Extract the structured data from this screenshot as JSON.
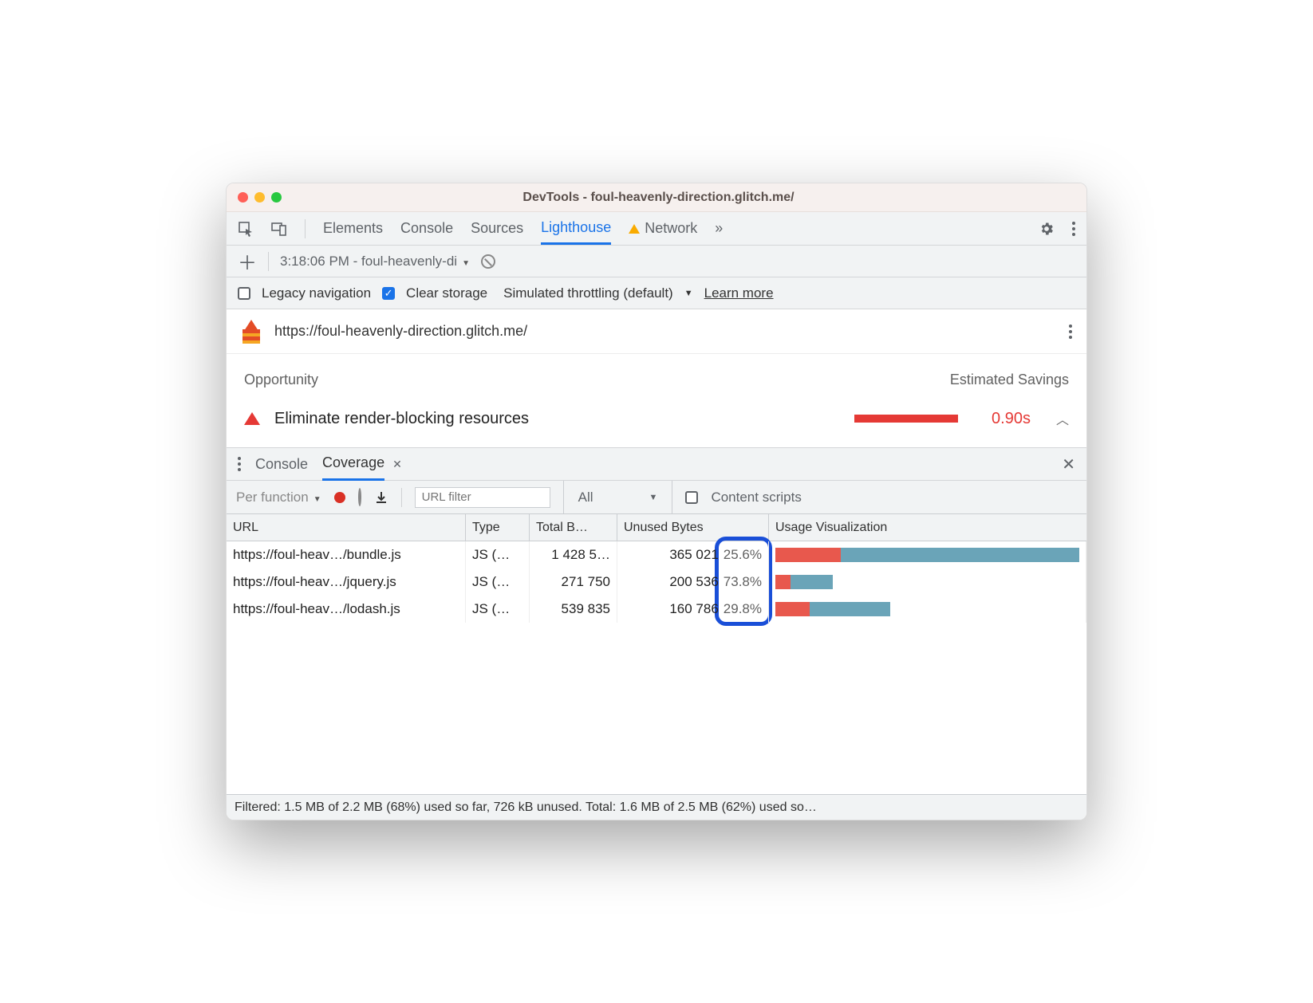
{
  "titlebar": {
    "title": "DevTools - foul-heavenly-direction.glitch.me/"
  },
  "tabs": {
    "items": [
      "Elements",
      "Console",
      "Sources",
      "Lighthouse",
      "Network"
    ],
    "active": "Lighthouse",
    "more": "»"
  },
  "run_bar": {
    "report_label": "3:18:06 PM - foul-heavenly-di"
  },
  "options": {
    "legacy_label": "Legacy navigation",
    "clear_label": "Clear storage",
    "throttle_label": "Simulated throttling (default)",
    "learn_more": "Learn more"
  },
  "audit": {
    "url": "https://foul-heavenly-direction.glitch.me/",
    "opportunity_header": "Opportunity",
    "savings_header": "Estimated Savings",
    "item_label": "Eliminate render-blocking resources",
    "item_time": "0.90s"
  },
  "drawer": {
    "tabs": [
      "Console",
      "Coverage"
    ],
    "active": "Coverage"
  },
  "coverage_toolbar": {
    "granularity": "Per function",
    "filter_placeholder": "URL filter",
    "type_filter": "All",
    "content_scripts": "Content scripts"
  },
  "coverage_table": {
    "headers": {
      "url": "URL",
      "type": "Type",
      "total": "Total B…",
      "unused": "Unused Bytes",
      "viz": "Usage Visualization"
    },
    "rows": [
      {
        "url": "https://foul-heav…/bundle.js",
        "type": "JS (…",
        "total": "1 428 5…",
        "unused": "365 021",
        "pct": "25.6%",
        "used_frac": 0.216,
        "total_frac": 1.0
      },
      {
        "url": "https://foul-heav…/jquery.js",
        "type": "JS (…",
        "total": "271 750",
        "unused": "200 536",
        "pct": "73.8%",
        "used_frac": 0.05,
        "total_frac": 0.19
      },
      {
        "url": "https://foul-heav…/lodash.js",
        "type": "JS (…",
        "total": "539 835",
        "unused": "160 786",
        "pct": "29.8%",
        "used_frac": 0.113,
        "total_frac": 0.378
      }
    ]
  },
  "status": "Filtered: 1.5 MB of 2.2 MB (68%) used so far, 726 kB unused. Total: 1.6 MB of 2.5 MB (62%) used so…"
}
